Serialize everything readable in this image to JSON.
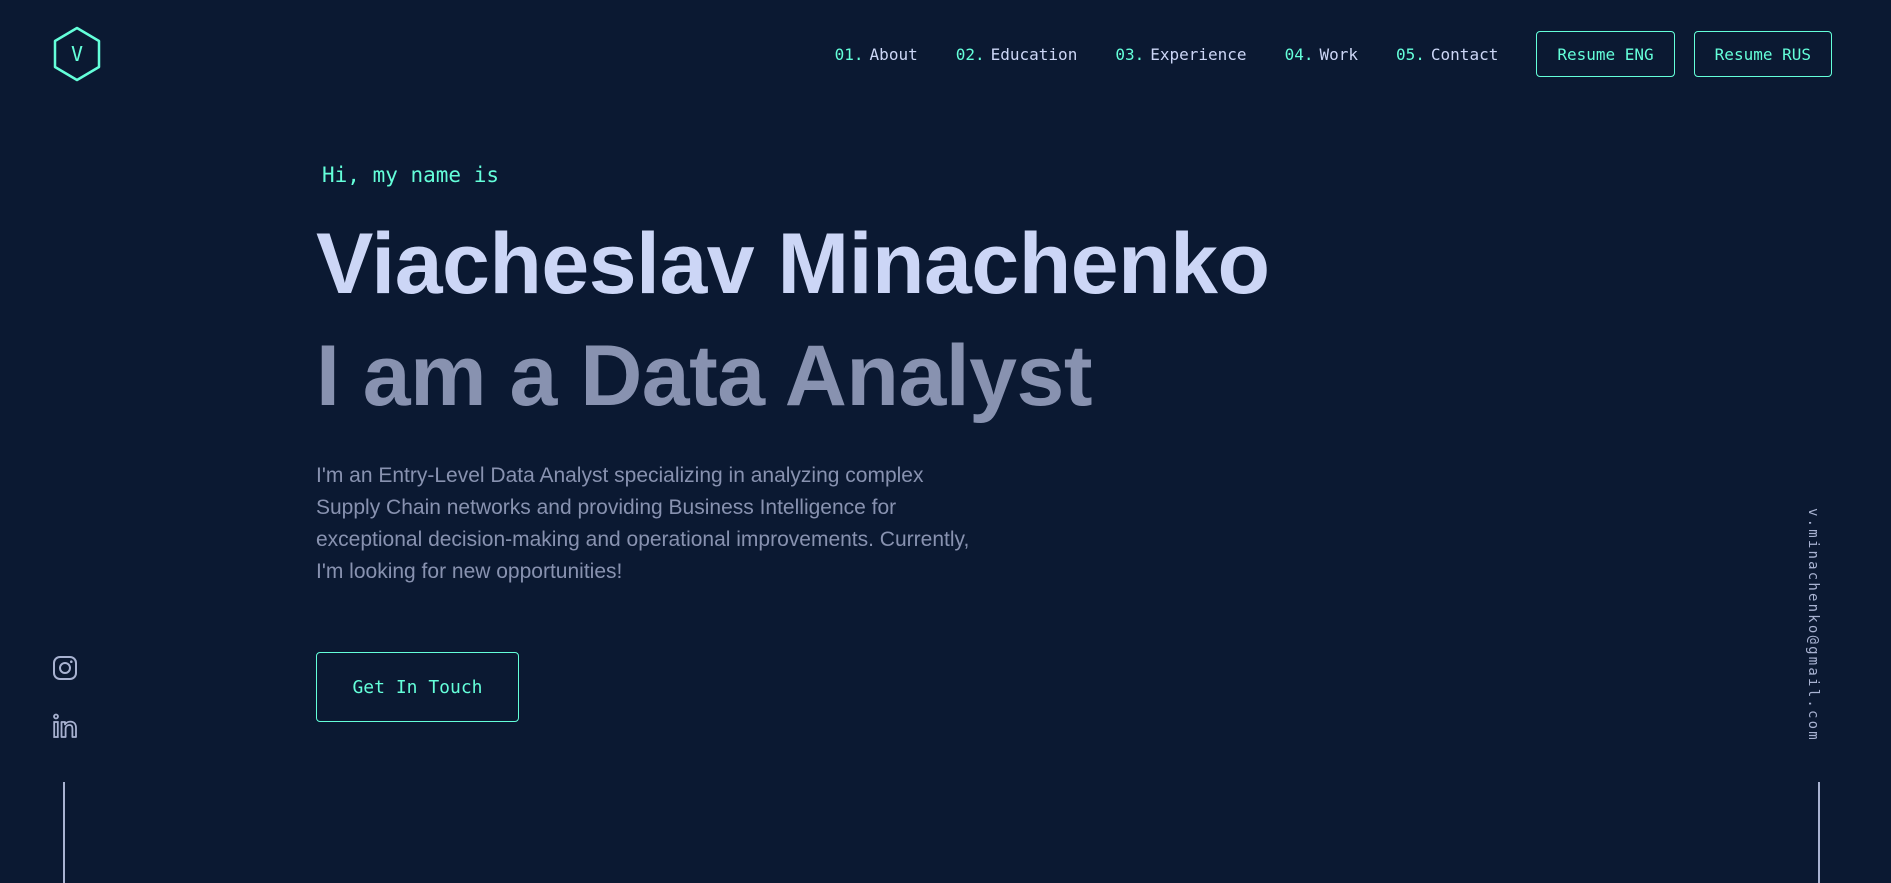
{
  "logo": {
    "letter": "V",
    "icon": "hexagon-logo-icon"
  },
  "nav": {
    "items": [
      {
        "num": "01.",
        "label": "About"
      },
      {
        "num": "02.",
        "label": "Education"
      },
      {
        "num": "03.",
        "label": "Experience"
      },
      {
        "num": "04.",
        "label": "Work"
      },
      {
        "num": "05.",
        "label": "Contact"
      }
    ],
    "resume_eng": "Resume ENG",
    "resume_rus": "Resume RUS"
  },
  "hero": {
    "greeting": "Hi, my name is",
    "name": "Viacheslav Minachenko",
    "tagline": "I am a Data Analyst",
    "description": "I'm an Entry-Level Data Analyst specializing in analyzing complex Supply Chain networks and providing Business Intelligence for exceptional decision-making and operational improvements. Currently, I'm looking for new opportunities!",
    "cta": "Get In Touch"
  },
  "socials": [
    {
      "icon": "instagram-icon"
    },
    {
      "icon": "linkedin-icon"
    }
  ],
  "email": "v.minachenko@gmail.com",
  "colors": {
    "background": "#0b1932",
    "accent": "#64ffda",
    "heading": "#ccd6f6",
    "muted": "#8892b0",
    "line": "#a8b2d1"
  }
}
